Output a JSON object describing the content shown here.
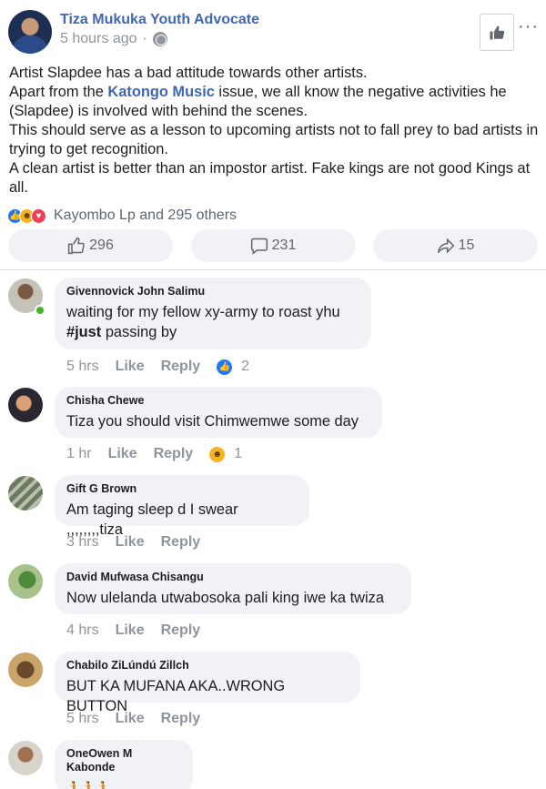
{
  "post": {
    "author": "Tiza Mukuka Youth Advocate",
    "time": "5 hours ago",
    "dot": "·",
    "more": "···",
    "body": {
      "line1": "Artist Slapdee has a bad attitude towards other artists.",
      "line2_before": "Apart from the ",
      "line2_mention": "Katongo Music",
      "line2_after": " issue, we all know the negative activities he (Slapdee) is involved with behind the scenes.",
      "line3": "This should serve as a lesson to upcoming artists not to fall prey to bad artists in trying to get recognition.",
      "line4": "A clean artist is better than an impostor artist. Fake kings are not good Kings at all."
    },
    "reactions_text": "Kayombo Lp and 295 others",
    "likes": "296",
    "comments": "231",
    "shares": "15"
  },
  "labels": {
    "like": "Like",
    "reply": "Reply"
  },
  "comments": [
    {
      "name": "Givennovick John Salimu",
      "text_plain": "waiting for my fellow xy-army to roast yhu",
      "hashtag": "#just",
      "text_after": " passing by",
      "time": "5 hrs",
      "reaction_count": "2"
    },
    {
      "name": "Chisha Chewe",
      "text": "Tiza you should visit Chimwemwe some day",
      "time": "1 hr",
      "reaction_count": "1"
    },
    {
      "name": "Gift G Brown",
      "text": "Am taging sleep d I swear ,,,,,,,,tiza",
      "time": "3 hrs"
    },
    {
      "name": "David Mufwasa Chisangu",
      "text": "Now ulelanda utwabosoka pali king iwe ka twiza",
      "time": "4 hrs"
    },
    {
      "name": "Chabilo ZiLúndú Zillch",
      "text": "BUT KA MUFANA AKA..WRONG BUTTON",
      "time": "5 hrs"
    },
    {
      "name": "OneOwen M Kabonde",
      "text": "🏃🏃🏃"
    }
  ],
  "colors": {
    "link": "#4267b2",
    "bubble": "#f0f2f5",
    "muted": "#90949c",
    "online": "#42b72a"
  },
  "icons": [
    "thumbs-up-icon",
    "comment-icon",
    "share-icon",
    "globe-icon",
    "like-reaction-icon",
    "haha-reaction-icon",
    "love-reaction-icon"
  ]
}
